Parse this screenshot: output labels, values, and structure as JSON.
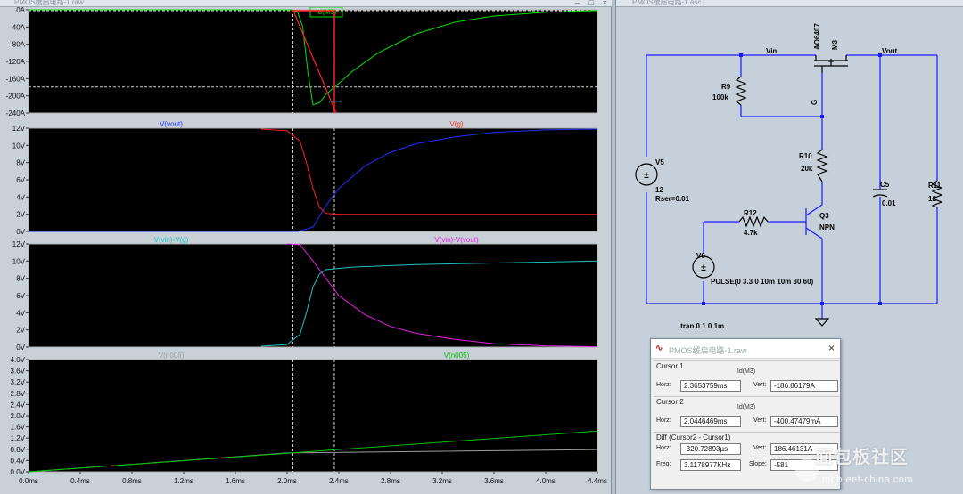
{
  "waveform_window": {
    "title": "PMOS缓启电路-1.raw",
    "panes": [
      {
        "id": "p1",
        "traces": [
          {
            "label": "Id(M3)",
            "color": "#00e000"
          }
        ],
        "y_ticks": [
          "0A",
          "-40A",
          "-80A",
          "-120A",
          "-160A",
          "-200A",
          "-240A"
        ],
        "y_range": [
          -250,
          0
        ]
      },
      {
        "id": "p2",
        "traces": [
          {
            "label": "V(vout)",
            "color": "#2030ff"
          },
          {
            "label": "V(g)",
            "color": "#ff2020"
          }
        ],
        "y_ticks": [
          "12V",
          "10V",
          "8V",
          "6V",
          "4V",
          "2V",
          "0V"
        ],
        "y_range": [
          0,
          12
        ]
      },
      {
        "id": "p3",
        "traces": [
          {
            "label": "V(vin)-V(g)",
            "color": "#20c0c0"
          },
          {
            "label": "V(vin)-V(vout)",
            "color": "#e020e0"
          }
        ],
        "y_ticks": [
          "12V",
          "10V",
          "8V",
          "6V",
          "4V",
          "2V",
          "0V"
        ],
        "y_range": [
          0,
          12
        ]
      },
      {
        "id": "p4",
        "traces": [
          {
            "label": "V(n006)",
            "color": "#a0a0a0"
          },
          {
            "label": "V(n005)",
            "color": "#00c000"
          }
        ],
        "y_ticks": [
          "4.0V",
          "3.6V",
          "3.2V",
          "2.8V",
          "2.4V",
          "2.0V",
          "1.6V",
          "1.2V",
          "0.8V",
          "0.4V",
          "0.0V"
        ],
        "y_range": [
          0,
          4
        ]
      }
    ],
    "x_ticks": [
      "0.0ms",
      "0.4ms",
      "0.8ms",
      "1.2ms",
      "1.6ms",
      "2.0ms",
      "2.4ms",
      "2.8ms",
      "3.2ms",
      "3.6ms",
      "4.0ms",
      "4.4ms"
    ],
    "x_range": [
      0,
      4.4
    ],
    "cursor1_x": 2.3653759,
    "cursor2_x": 2.0446469,
    "cursor_ref_y": -186.86
  },
  "chart_data": {
    "type": "line",
    "x_unit": "ms",
    "series": [
      {
        "name": "Id(M3)",
        "points": [
          [
            0,
            0
          ],
          [
            2.04,
            0
          ],
          [
            2.08,
            -5
          ],
          [
            2.12,
            -40
          ],
          [
            2.16,
            -150
          ],
          [
            2.2,
            -230
          ],
          [
            2.25,
            -225
          ],
          [
            2.3,
            -205
          ],
          [
            2.37,
            -187
          ],
          [
            2.5,
            -150
          ],
          [
            2.7,
            -105
          ],
          [
            3.0,
            -58
          ],
          [
            3.3,
            -30
          ],
          [
            3.6,
            -15
          ],
          [
            4.0,
            -6
          ],
          [
            4.4,
            -2
          ]
        ]
      },
      {
        "name": "V(vout)",
        "points": [
          [
            0,
            0
          ],
          [
            2.08,
            0
          ],
          [
            2.2,
            0.5
          ],
          [
            2.3,
            3
          ],
          [
            2.4,
            5
          ],
          [
            2.6,
            7.6
          ],
          [
            2.8,
            9.2
          ],
          [
            3.0,
            10.2
          ],
          [
            3.3,
            11
          ],
          [
            3.6,
            11.5
          ],
          [
            4.0,
            11.8
          ],
          [
            4.4,
            11.9
          ]
        ]
      },
      {
        "name": "V(g)",
        "points": [
          [
            1.8,
            11.9
          ],
          [
            2.0,
            11.7
          ],
          [
            2.1,
            10.5
          ],
          [
            2.15,
            8
          ],
          [
            2.2,
            5
          ],
          [
            2.25,
            2.8
          ],
          [
            2.3,
            2.1
          ],
          [
            2.4,
            2.0
          ],
          [
            4.4,
            2.0
          ]
        ]
      },
      {
        "name": "V(vin)-V(g)",
        "points": [
          [
            1.8,
            0.1
          ],
          [
            2.0,
            0.3
          ],
          [
            2.1,
            1.5
          ],
          [
            2.15,
            4
          ],
          [
            2.2,
            7
          ],
          [
            2.25,
            8.5
          ],
          [
            2.3,
            9.0
          ],
          [
            2.5,
            9.3
          ],
          [
            3.0,
            9.6
          ],
          [
            4.4,
            10.0
          ]
        ]
      },
      {
        "name": "V(vin)-V(vout)",
        "points": [
          [
            2.0,
            12
          ],
          [
            2.1,
            11.9
          ],
          [
            2.2,
            10
          ],
          [
            2.3,
            8
          ],
          [
            2.4,
            6
          ],
          [
            2.6,
            3.8
          ],
          [
            2.8,
            2.4
          ],
          [
            3.0,
            1.6
          ],
          [
            3.3,
            0.9
          ],
          [
            3.6,
            0.4
          ],
          [
            4.0,
            0.15
          ],
          [
            4.4,
            0.05
          ]
        ]
      },
      {
        "name": "V(n006)",
        "points": [
          [
            0,
            0
          ],
          [
            2.0,
            0.67
          ],
          [
            4.4,
            0.79
          ]
        ]
      },
      {
        "name": "V(n005)",
        "points": [
          [
            0,
            0
          ],
          [
            4.4,
            1.45
          ]
        ]
      }
    ]
  },
  "schematic": {
    "title": "PMOS缓启电路-1.asc",
    "labels": {
      "vin": "Vin",
      "vout": "Vout",
      "m3_model": "AO6407",
      "m3_name": "M3",
      "g": "G",
      "r9_name": "R9",
      "r9_val": "100k",
      "r10_name": "R10",
      "r10_val": "20k",
      "r11_name": "R11",
      "r11_val": "12",
      "r12_name": "R12",
      "r12_val": "4.7k",
      "c5_name": "C5",
      "c5_val": "0.01",
      "v5_name": "V5",
      "v5_val": "12",
      "v5_rser": "Rser=0.01",
      "q3_name": "Q3",
      "q3_model": "NPN",
      "v6_name": "V6",
      "v6_val": "PULSE(0 3.3 0 10m 10m 30 60)",
      "tran": ".tran 0 1 0 1m"
    }
  },
  "cursor_dialog": {
    "title": "PMOS缓启电路-1.raw",
    "cursor1": {
      "label": "Cursor 1",
      "trace": "Id(M3)",
      "horz_label": "Horz:",
      "horz": "2.3653759ms",
      "vert_label": "Vert:",
      "vert": "-186.86179A"
    },
    "cursor2": {
      "label": "Cursor 2",
      "trace": "Id(M3)",
      "horz_label": "Horz:",
      "horz": "2.0446469ms",
      "vert_label": "Vert:",
      "vert": "-400.47479mA"
    },
    "diff": {
      "label": "Diff (Cursor2 - Cursor1)",
      "horz_label": "Horz:",
      "horz": "-320.72893µs",
      "vert_label": "Vert:",
      "vert": "186.46131A",
      "freq_label": "Freq:",
      "freq": "3.1178977KHz",
      "slope_label": "Slope:",
      "slope": "-581"
    },
    "close_glyph": "×"
  },
  "watermark": {
    "text": "面包板社区",
    "url": "mbb.eet-china.com"
  }
}
